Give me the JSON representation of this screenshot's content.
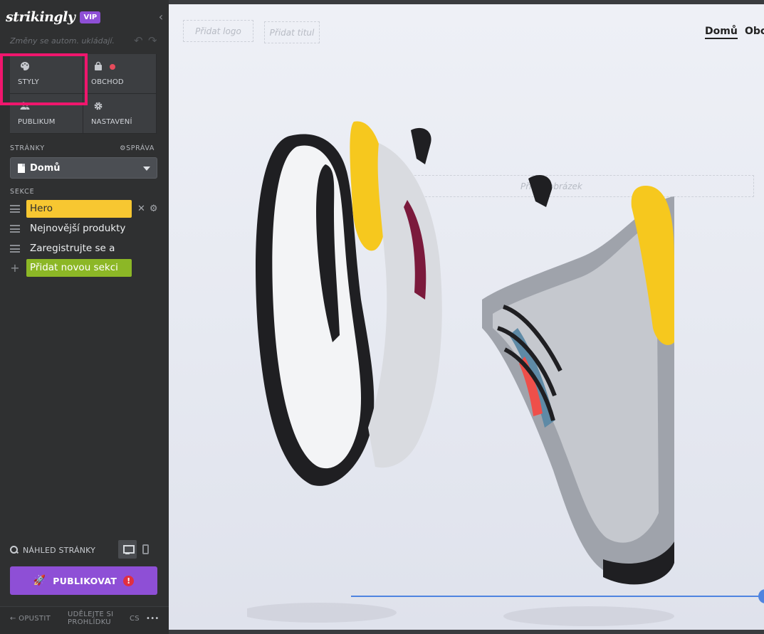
{
  "sidebar": {
    "logo": "strikingly",
    "badge": "VIP",
    "collapse_icon": "chevron-left-icon",
    "autosave_text": "Změny se autom. ukládají.",
    "tiles": [
      {
        "label": "STYLY",
        "icon": "palette-icon"
      },
      {
        "label": "OBCHOD",
        "icon": "bag-icon"
      },
      {
        "label": "PUBLIKUM",
        "icon": "users-icon"
      },
      {
        "label": "NASTAVENÍ",
        "icon": "gear-icon"
      }
    ],
    "pages_heading": "STRÁNKY",
    "manage_label": "SPRÁVA",
    "current_page": "Domů",
    "sections_heading": "SEKCE",
    "sections": [
      {
        "label": "Hero"
      },
      {
        "label": "Nejnovější produkty"
      },
      {
        "label": "Zaregistrujte se a"
      }
    ],
    "add_section": "Přidat novou sekci",
    "preview_label": "NÁHLED STRÁNKY",
    "publish_label": "PUBLIKOVAT",
    "publish_warning": "!",
    "footer": {
      "leave": "OPUSTIT",
      "tour_line1": "UDĚLEJTE SI",
      "tour_line2": "PROHLÍDKU",
      "lang": "CS",
      "more": "•••"
    }
  },
  "canvas": {
    "add_logo": "Přidat logo",
    "add_title": "Přidat titul",
    "add_image": "Přidat obrázek",
    "nav": {
      "home": "Domů",
      "shop": "Obc"
    }
  },
  "colors": {
    "accent_purple": "#8e4fd6",
    "hero_yellow": "#f7c731",
    "add_green": "#8cb726",
    "highlight_pink": "#f0166d",
    "divider_blue": "#4f84e0"
  }
}
